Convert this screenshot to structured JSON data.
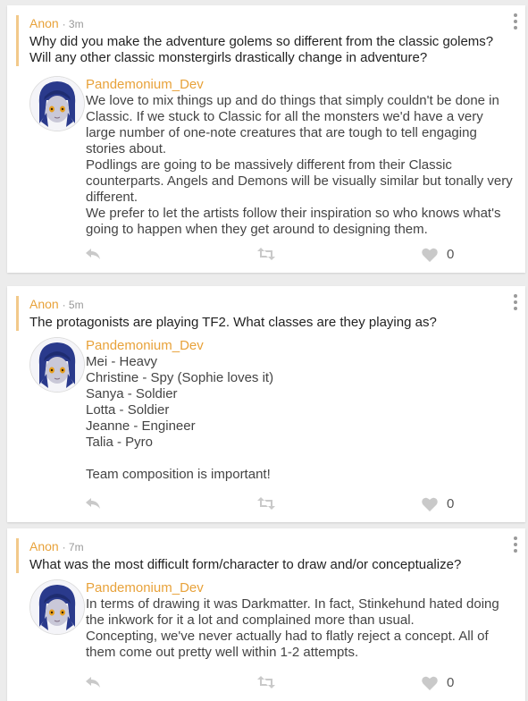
{
  "posts": [
    {
      "author": "Anon",
      "time": "· 3m",
      "question": "Why did you make the adventure golems so different from the classic golems? Will any other classic monstergirls drastically change in adventure?",
      "answerer": "Pandemonium_Dev",
      "answer": [
        "We love to mix things up and do things that simply couldn't be done in Classic. If we stuck to Classic for all the monsters we'd have a very large number of one-note creatures that are tough to tell engaging stories about.",
        "Podlings are going to be massively different from their Classic counterparts. Angels and Demons will be visually similar but tonally very different.",
        "We prefer to let the artists follow their inspiration so who knows what's going to happen when they get around to designing them."
      ],
      "likes": "0"
    },
    {
      "author": "Anon",
      "time": "· 5m",
      "question": "The protagonists are playing TF2. What classes are they playing as?",
      "answerer": "Pandemonium_Dev",
      "answer": [
        "Mei - Heavy",
        "Christine - Spy (Sophie loves it)",
        "Sanya - Soldier",
        "Lotta - Soldier",
        "Jeanne - Engineer",
        "Talia - Pyro",
        "",
        "Team composition is important!"
      ],
      "likes": "0"
    },
    {
      "author": "Anon",
      "time": "· 7m",
      "question": "What was the most difficult form/character to draw and/or conceptualize?",
      "answerer": "Pandemonium_Dev",
      "answer": [
        "In terms of drawing it was Darkmatter. In fact, Stinkehund hated doing the inkwork for it a lot and complained more than usual.",
        "Concepting, we've never actually had to flatly reject a concept. All of them come out pretty well within 1-2 attempts."
      ],
      "likes": "0"
    }
  ],
  "icons": {
    "menu": "kebab-menu-icon",
    "reply": "reply-icon",
    "retweet": "retweet-icon",
    "like": "heart-icon"
  },
  "colors": {
    "author": "#e8a23a",
    "quote_bar": "#f2c98a",
    "icon": "#c9c9c9",
    "background": "#ececec"
  }
}
